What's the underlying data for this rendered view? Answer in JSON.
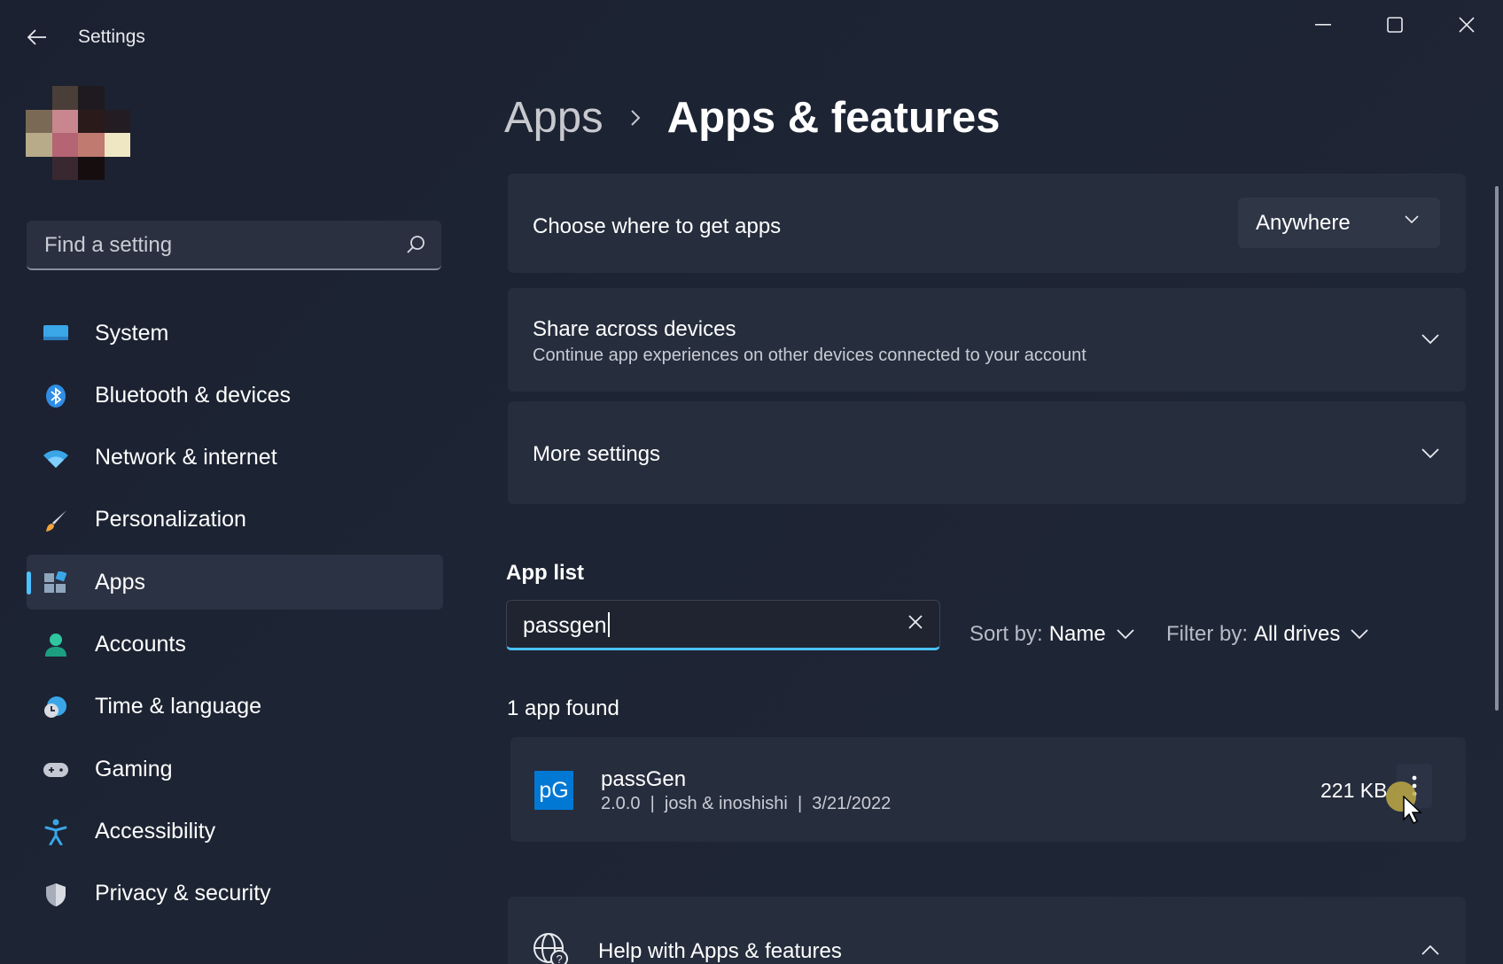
{
  "window": {
    "title": "Settings",
    "accent": "#4cc2ff"
  },
  "sidebar": {
    "search_placeholder": "Find a setting",
    "items": [
      {
        "label": "System",
        "icon": "system-icon"
      },
      {
        "label": "Bluetooth & devices",
        "icon": "bluetooth-icon"
      },
      {
        "label": "Network & internet",
        "icon": "wifi-icon"
      },
      {
        "label": "Personalization",
        "icon": "brush-icon"
      },
      {
        "label": "Apps",
        "icon": "apps-icon",
        "active": true
      },
      {
        "label": "Accounts",
        "icon": "person-icon"
      },
      {
        "label": "Time & language",
        "icon": "clock-globe-icon"
      },
      {
        "label": "Gaming",
        "icon": "gamepad-icon"
      },
      {
        "label": "Accessibility",
        "icon": "accessibility-icon"
      },
      {
        "label": "Privacy & security",
        "icon": "shield-icon"
      }
    ]
  },
  "breadcrumb": {
    "parent": "Apps",
    "current": "Apps & features"
  },
  "settings": {
    "choose_where": {
      "title": "Choose where to get apps",
      "dropdown_value": "Anywhere"
    },
    "share": {
      "title": "Share across devices",
      "subtitle": "Continue app experiences on other devices connected to your account"
    },
    "more": {
      "title": "More settings"
    }
  },
  "app_list": {
    "heading": "App list",
    "search_value": "passgen",
    "sort_label": "Sort by:",
    "sort_value": "Name",
    "filter_label": "Filter by:",
    "filter_value": "All drives",
    "found_text": "1 app found",
    "apps": [
      {
        "icon_text": "pG",
        "name": "passGen",
        "meta": "2.0.0  |  josh & inoshishi  |  3/21/2022",
        "size": "221 KB"
      }
    ]
  },
  "help": {
    "title": "Help with Apps & features"
  }
}
